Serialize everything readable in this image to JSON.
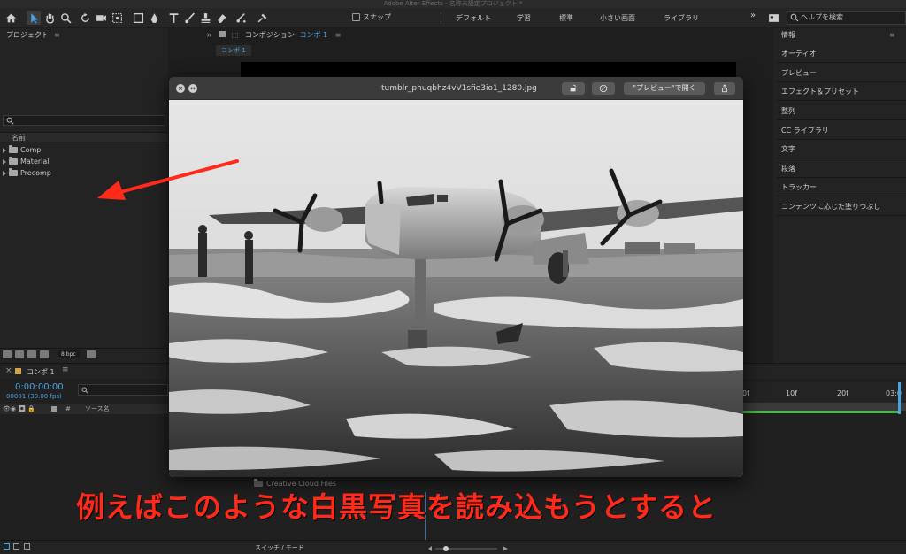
{
  "window": {
    "title": "Adobe After Effects - 名称未設定プロジェクト *"
  },
  "toolbar": {
    "snap_label": "スナップ",
    "workspaces": [
      "デフォルト",
      "学習",
      "標準",
      "小さい画面",
      "ライブラリ"
    ],
    "more": "»",
    "help_search_placeholder": "ヘルプを検索"
  },
  "project": {
    "title": "プロジェクト",
    "column_name": "名前",
    "items": [
      {
        "label": "Comp"
      },
      {
        "label": "Material"
      },
      {
        "label": "Precomp"
      }
    ],
    "bpc": "8 bpc"
  },
  "composition": {
    "title": "コンポジション",
    "comp_name": "コンポ 1",
    "tab_label": "コンポ 1"
  },
  "right_panel": {
    "title": "情報",
    "items": [
      "オーディオ",
      "プレビュー",
      "エフェクト＆プリセット",
      "整列",
      "CC ライブラリ",
      "文字",
      "段落",
      "トラッカー",
      "コンテンツに応じた塗りつぶし"
    ]
  },
  "timeline": {
    "comp_name": "コンポ 1",
    "timecode": "0:00:00:00",
    "fps": "00001 (30.00 fps)",
    "col_hash": "#",
    "col_source": "ソース名",
    "ruler": [
      "0f",
      "10f",
      "20f",
      "03:0"
    ],
    "switch_mode": "スイッチ / モード"
  },
  "quicklook": {
    "filename": "tumblr_phuqbhz4vV1sfie3io1_1280.jpg",
    "open_button": "\"プレビュー\"で開く"
  },
  "browser": {
    "cc_files": "Creative Cloud Files"
  },
  "caption": {
    "text": "例えばこのような白黒写真を読み込もうとすると"
  },
  "colors": {
    "accent_blue": "#4aa3e0",
    "arrow_red": "#ff2a1a",
    "caption_red": "#ff2a1a"
  }
}
